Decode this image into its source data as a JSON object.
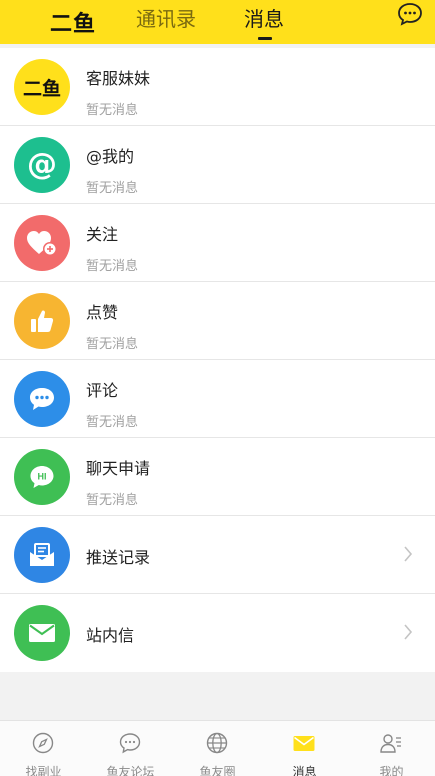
{
  "header": {
    "logo": "二鱼",
    "tab_contacts": "通讯录",
    "tab_messages": "消息",
    "chat_icon": "chat-bubble-icon"
  },
  "messages": [
    {
      "title": "客服妹妹",
      "subtitle": "暂无消息",
      "icon": "logo-avatar",
      "color": "#ffe01b",
      "logo_text": "二鱼"
    },
    {
      "title": "@我的",
      "subtitle": "暂无消息",
      "icon": "at-icon",
      "color": "#1dbf8f"
    },
    {
      "title": "关注",
      "subtitle": "暂无消息",
      "icon": "heart-plus-icon",
      "color": "#f26b6b"
    },
    {
      "title": "点赞",
      "subtitle": "暂无消息",
      "icon": "thumbs-up-icon",
      "color": "#f7b531"
    },
    {
      "title": "评论",
      "subtitle": "暂无消息",
      "icon": "comment-icon",
      "color": "#2d8ee8"
    },
    {
      "title": "聊天申请",
      "subtitle": "暂无消息",
      "icon": "hi-bubble-icon",
      "color": "#3fbf54",
      "bubble_text": "HI"
    },
    {
      "title": "推送记录",
      "icon": "push-envelope-icon",
      "color": "#2f86e4"
    },
    {
      "title": "站内信",
      "icon": "mail-icon",
      "color": "#3fbf54"
    }
  ],
  "tabbar": [
    {
      "label": "找副业",
      "icon": "compass-icon"
    },
    {
      "label": "鱼友论坛",
      "icon": "forum-bubble-icon"
    },
    {
      "label": "鱼友圈",
      "icon": "globe-icon"
    },
    {
      "label": "消息",
      "icon": "envelope-icon",
      "active": true,
      "active_color": "#ffe01b"
    },
    {
      "label": "我的",
      "icon": "profile-icon"
    }
  ]
}
